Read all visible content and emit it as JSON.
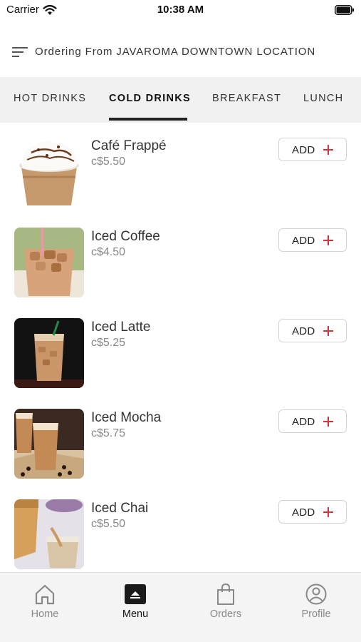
{
  "status_bar": {
    "carrier": "Carrier",
    "time": "10:38 AM"
  },
  "header": {
    "location_text": "Ordering From JAVAROMA DOWNTOWN LOCATION"
  },
  "tabs": [
    {
      "label": "HOT DRINKS",
      "active": false
    },
    {
      "label": "COLD DRINKS",
      "active": true
    },
    {
      "label": "BREAKFAST",
      "active": false
    },
    {
      "label": "LUNCH",
      "active": false
    }
  ],
  "items": [
    {
      "name": "Café Frappé",
      "price": "c$5.50",
      "add_label": "ADD"
    },
    {
      "name": "Iced Coffee",
      "price": "c$4.50",
      "add_label": "ADD"
    },
    {
      "name": "Iced Latte",
      "price": "c$5.25",
      "add_label": "ADD"
    },
    {
      "name": "Iced Mocha",
      "price": "c$5.75",
      "add_label": "ADD"
    },
    {
      "name": "Iced Chai",
      "price": "c$5.50",
      "add_label": "ADD"
    }
  ],
  "bottom_nav": [
    {
      "label": "Home",
      "icon": "home-icon",
      "active": false
    },
    {
      "label": "Menu",
      "icon": "menu-tray-icon",
      "active": true
    },
    {
      "label": "Orders",
      "icon": "shopping-bag-icon",
      "active": false
    },
    {
      "label": "Profile",
      "icon": "profile-icon",
      "active": false
    }
  ],
  "colors": {
    "accent": "#d0343a",
    "tab_bar_bg": "#f1f1f2",
    "nav_bg": "#f4f4f5",
    "active_text": "#111111",
    "inactive_text": "#888888"
  }
}
